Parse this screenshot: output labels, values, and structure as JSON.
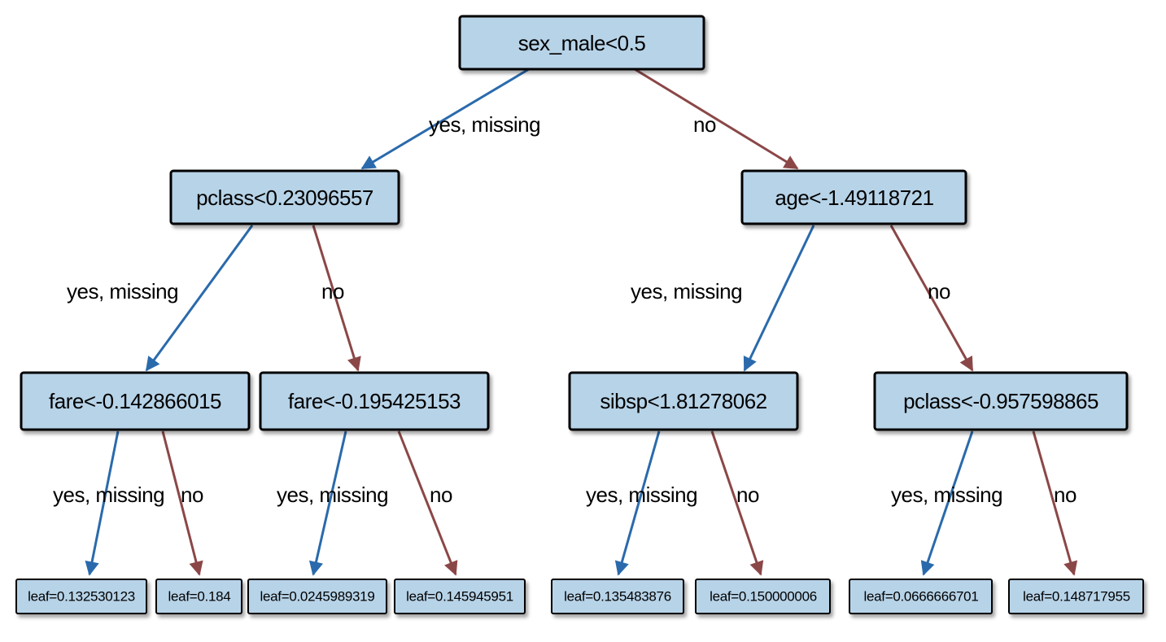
{
  "tree": {
    "root": {
      "label": "sex_male<0.5"
    },
    "level1": {
      "left": {
        "label": "pclass<0.23096557"
      },
      "right": {
        "label": "age<-1.49118721"
      }
    },
    "level2": {
      "n0": {
        "label": "fare<-0.142866015"
      },
      "n1": {
        "label": "fare<-0.195425153"
      },
      "n2": {
        "label": "sibsp<1.81278062"
      },
      "n3": {
        "label": "pclass<-0.957598865"
      }
    },
    "leaves": {
      "l0": {
        "label": "leaf=0.132530123"
      },
      "l1": {
        "label": "leaf=0.184"
      },
      "l2": {
        "label": "leaf=0.0245989319"
      },
      "l3": {
        "label": "leaf=0.145945951"
      },
      "l4": {
        "label": "leaf=0.135483876"
      },
      "l5": {
        "label": "leaf=0.150000006"
      },
      "l6": {
        "label": "leaf=0.0666666701"
      },
      "l7": {
        "label": "leaf=0.148717955"
      }
    },
    "edgeLabels": {
      "yes": "yes, missing",
      "no": "no"
    }
  },
  "chart_data": {
    "type": "decision-tree",
    "nodes": [
      {
        "id": 0,
        "depth": 0,
        "split": "sex_male<0.5",
        "yes": 1,
        "no": 2,
        "missing": 1
      },
      {
        "id": 1,
        "depth": 1,
        "split": "pclass<0.23096557",
        "yes": 3,
        "no": 4,
        "missing": 3
      },
      {
        "id": 2,
        "depth": 1,
        "split": "age<-1.49118721",
        "yes": 5,
        "no": 6,
        "missing": 5
      },
      {
        "id": 3,
        "depth": 2,
        "split": "fare<-0.142866015",
        "yes": 7,
        "no": 8,
        "missing": 7
      },
      {
        "id": 4,
        "depth": 2,
        "split": "fare<-0.195425153",
        "yes": 9,
        "no": 10,
        "missing": 9
      },
      {
        "id": 5,
        "depth": 2,
        "split": "sibsp<1.81278062",
        "yes": 11,
        "no": 12,
        "missing": 11
      },
      {
        "id": 6,
        "depth": 2,
        "split": "pclass<-0.957598865",
        "yes": 13,
        "no": 14,
        "missing": 13
      },
      {
        "id": 7,
        "depth": 3,
        "leaf": 0.132530123
      },
      {
        "id": 8,
        "depth": 3,
        "leaf": 0.184
      },
      {
        "id": 9,
        "depth": 3,
        "leaf": 0.0245989319
      },
      {
        "id": 10,
        "depth": 3,
        "leaf": 0.145945951
      },
      {
        "id": 11,
        "depth": 3,
        "leaf": 0.135483876
      },
      {
        "id": 12,
        "depth": 3,
        "leaf": 0.150000006
      },
      {
        "id": 13,
        "depth": 3,
        "leaf": 0.0666666701
      },
      {
        "id": 14,
        "depth": 3,
        "leaf": 0.148717955
      }
    ]
  }
}
